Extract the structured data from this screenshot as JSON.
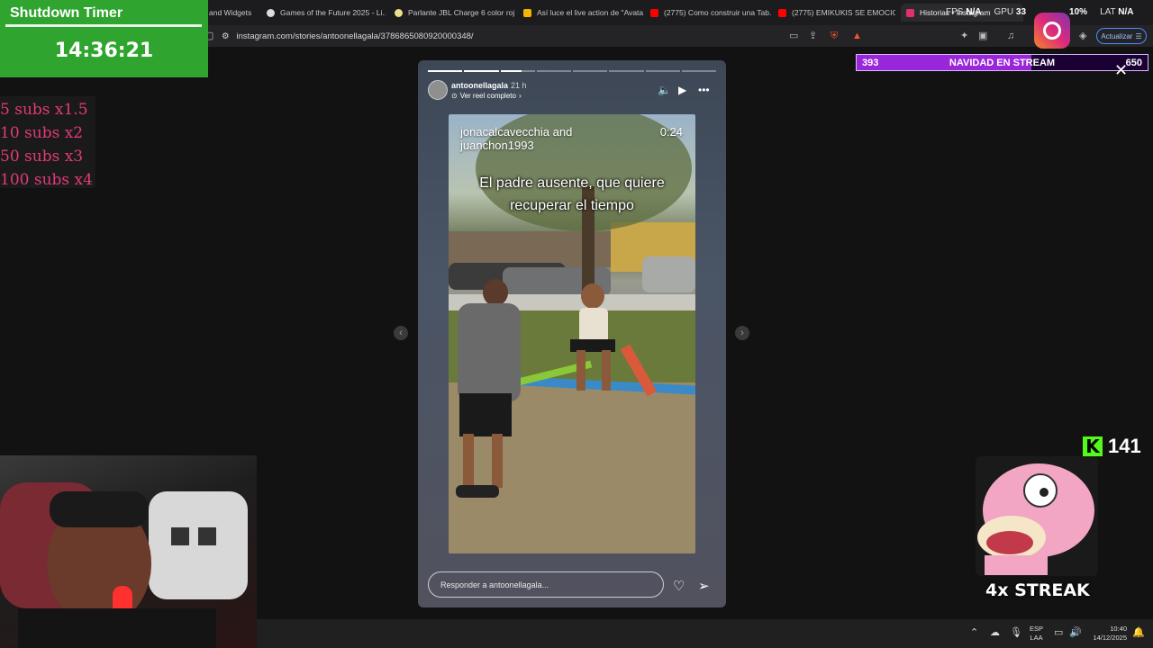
{
  "browser": {
    "tabs": [
      {
        "label": "and Widgets",
        "color": "#888888"
      },
      {
        "label": "Games of the Future 2025 - Li...",
        "color": "#dddddd"
      },
      {
        "label": "Parlante JBL Charge 6 color roj...",
        "color": "#e8e08a"
      },
      {
        "label": "Así luce el live action de \"Avata...",
        "color": "#f5b400"
      },
      {
        "label": "(2775) Como construir una Tab...",
        "color": "#ff0000"
      },
      {
        "label": "(2775) EMIKUKIS SE EMOCION...",
        "color": "#ff0000"
      },
      {
        "label": "Historias • Instagram",
        "color": "#e1306c"
      }
    ],
    "url": "instagram.com/stories/antoonellagala/3786865080920000348/",
    "update_label": "Actualizar",
    "notif_count": "1"
  },
  "stats": {
    "fps_label": "FPS",
    "fps": "N/A",
    "gpu_label": "GPU",
    "gpu": "33",
    "cpu": "10%",
    "lat_label": "LAT",
    "lat": "N/A"
  },
  "timer": {
    "title": "Shutdown Timer",
    "time": "14:36:21"
  },
  "subs": [
    "5 subs x1.5",
    "10 subs x2",
    "50 subs x3",
    "100 subs x4"
  ],
  "story": {
    "progress": {
      "segments": 8,
      "done": 2,
      "current": 0.6
    },
    "username": "antoonellagala",
    "age": "21 h",
    "reel_link": "Ver reel completo",
    "video_credit": "jonacalcavecchia and juanchon1993",
    "video_time": "0:24",
    "caption_line1": "El padre ausente, que quiere",
    "caption_line2": "recuperar el tiempo",
    "reply_placeholder": "Responder a antoonellagala..."
  },
  "navidad": {
    "left": "393",
    "title": "NAVIDAD EN STREAM",
    "right": "650",
    "progress": 0.6
  },
  "kick": {
    "count": "141"
  },
  "streak": "4x STREAK",
  "taskbar": {
    "lang1": "ESP",
    "lang2": "LAA",
    "time": "10:40",
    "date": "14/12/2025"
  }
}
